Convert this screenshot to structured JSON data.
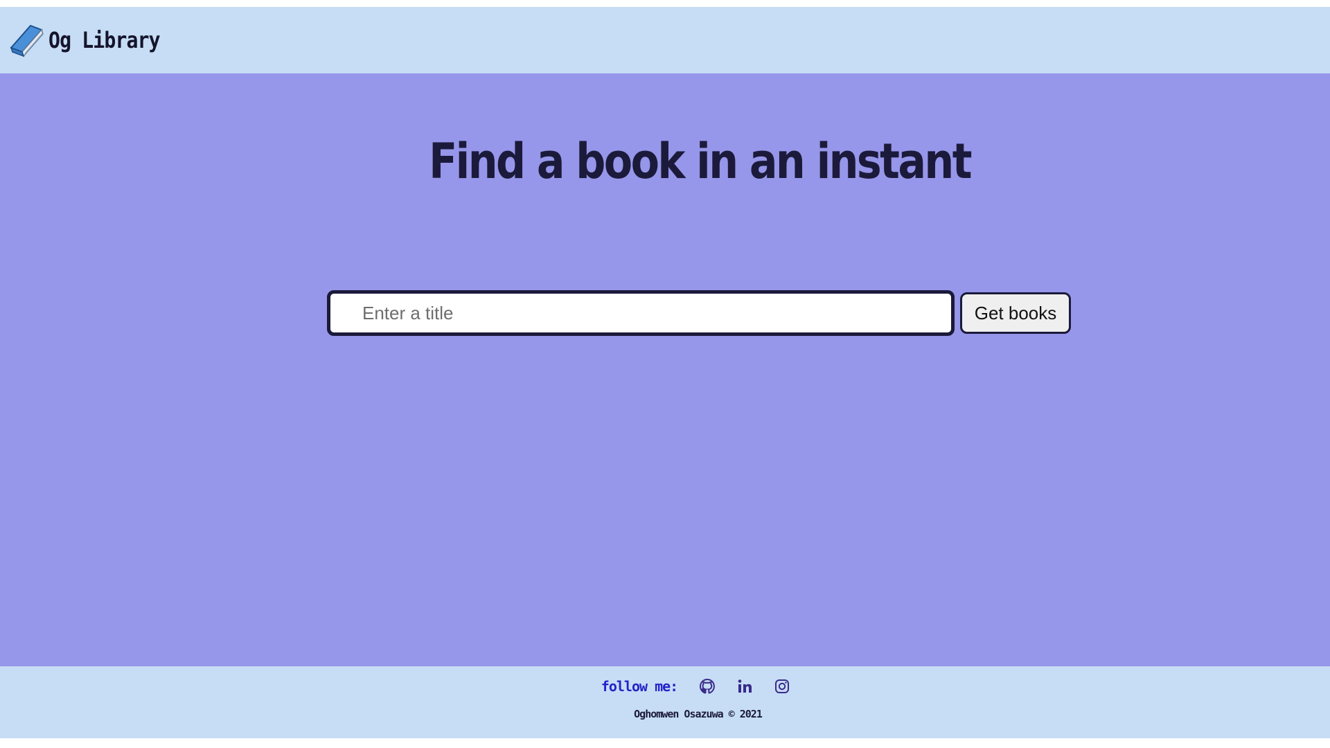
{
  "colors": {
    "navbar_bg": "#c6ddf5",
    "main_bg": "#9696ea",
    "footer_bg": "#c6ddf5",
    "text_dark": "#1b1a3a",
    "follow_accent": "#2323c8"
  },
  "navbar": {
    "brand_icon": "book-icon",
    "brand_title": "Og Library"
  },
  "main": {
    "title": "Find a book in an instant",
    "search": {
      "placeholder": "Enter a title",
      "value": ""
    },
    "button_label": "Get books"
  },
  "footer": {
    "follow_label": "follow me:",
    "social": [
      {
        "name": "github",
        "icon": "github-icon"
      },
      {
        "name": "linkedin",
        "icon": "linkedin-icon"
      },
      {
        "name": "instagram",
        "icon": "instagram-icon"
      }
    ],
    "copyright": "Oghomwen Osazuwa © 2021"
  }
}
